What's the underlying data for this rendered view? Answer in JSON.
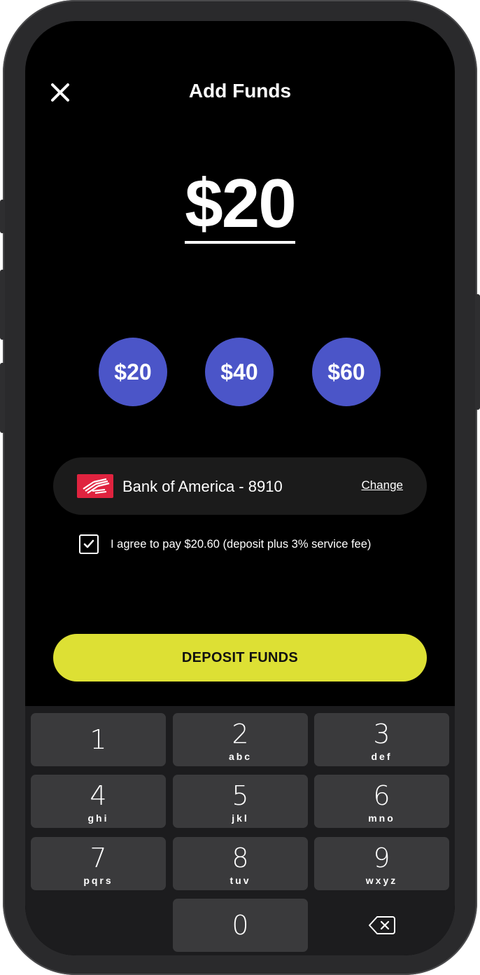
{
  "header": {
    "title": "Add Funds",
    "close_icon": "close-icon"
  },
  "amount": {
    "value": "$20"
  },
  "presets": [
    {
      "label": "$20"
    },
    {
      "label": "$40"
    },
    {
      "label": "$60"
    }
  ],
  "payment": {
    "bank": "Bank of America - 8910",
    "change_label": "Change",
    "logo_icon": "bank-of-america-logo"
  },
  "agreement": {
    "checked": true,
    "text": "I agree to pay $20.60 (deposit plus 3% service fee)"
  },
  "deposit_button": {
    "label": "DEPOSIT FUNDS"
  },
  "keypad": {
    "keys": [
      {
        "num": "1",
        "letters": ""
      },
      {
        "num": "2",
        "letters": "abc"
      },
      {
        "num": "3",
        "letters": "def"
      },
      {
        "num": "4",
        "letters": "ghi"
      },
      {
        "num": "5",
        "letters": "jkl"
      },
      {
        "num": "6",
        "letters": "mno"
      },
      {
        "num": "7",
        "letters": "pqrs"
      },
      {
        "num": "8",
        "letters": "tuv"
      },
      {
        "num": "9",
        "letters": "wxyz"
      },
      {
        "num": "0",
        "letters": ""
      }
    ],
    "delete_icon": "backspace-icon"
  },
  "colors": {
    "accent": "#dde034",
    "preset": "#4b55c8",
    "background": "#000000",
    "bank_red": "#e0233f"
  }
}
